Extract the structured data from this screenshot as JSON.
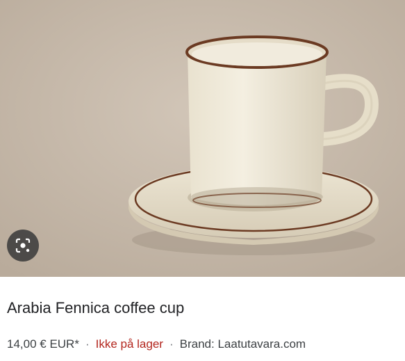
{
  "product": {
    "image_alt": "Arabia Fennica coffee cup",
    "title": "Arabia Fennica coffee cup",
    "price": "14,00 € EUR*",
    "stock_status": "Ikke på lager",
    "brand": "Brand: Laatutavara.com",
    "separator": "·"
  },
  "icons": {
    "lens": "visual-search-icon"
  },
  "colors": {
    "background_photo": "#c4b7a8",
    "porcelain": "#ece4d2",
    "rim_brown": "#6b3a22",
    "stock_red": "#b3261e",
    "title_text": "#202124"
  }
}
